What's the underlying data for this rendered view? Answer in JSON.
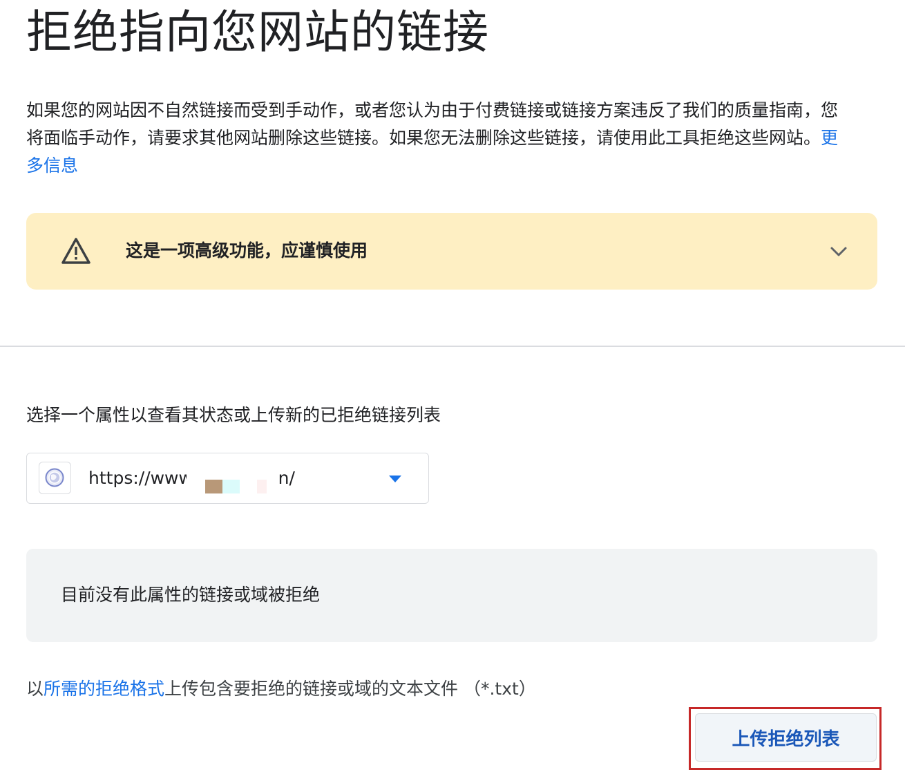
{
  "page": {
    "title": "拒绝指向您网站的链接"
  },
  "intro": {
    "text": "如果您的网站因不自然链接而受到手动作，或者您认为由于付费链接或链接方案违反了我们的质量指南，您将面临手动作，请要求其他网站删除这些链接。如果您无法删除这些链接，请使用此工具拒绝这些网站。",
    "more_info_link": "更多信息"
  },
  "warning": {
    "text": "这是一项高级功能，应谨慎使用",
    "icon": "warning-triangle-icon",
    "expand_icon": "chevron-down-icon"
  },
  "property": {
    "label": "选择一个属性以查看其状态或上传新的已拒绝链接列表",
    "selected_prefix": "https://www.",
    "selected_suffix": "n/",
    "icon": "globe-icon"
  },
  "status": {
    "empty_message": "目前没有此属性的链接或域被拒绝"
  },
  "upload": {
    "hint_prefix": "以",
    "format_link": "所需的拒绝格式",
    "hint_suffix": "上传包含要拒绝的链接或域的文本文件 （*.txt）",
    "button_label": "上传拒绝列表"
  },
  "colors": {
    "link": "#1a73e8",
    "warning_bg": "#feefc3",
    "highlight": "#c62828",
    "dropdown_arrow": "#1a73e8"
  }
}
